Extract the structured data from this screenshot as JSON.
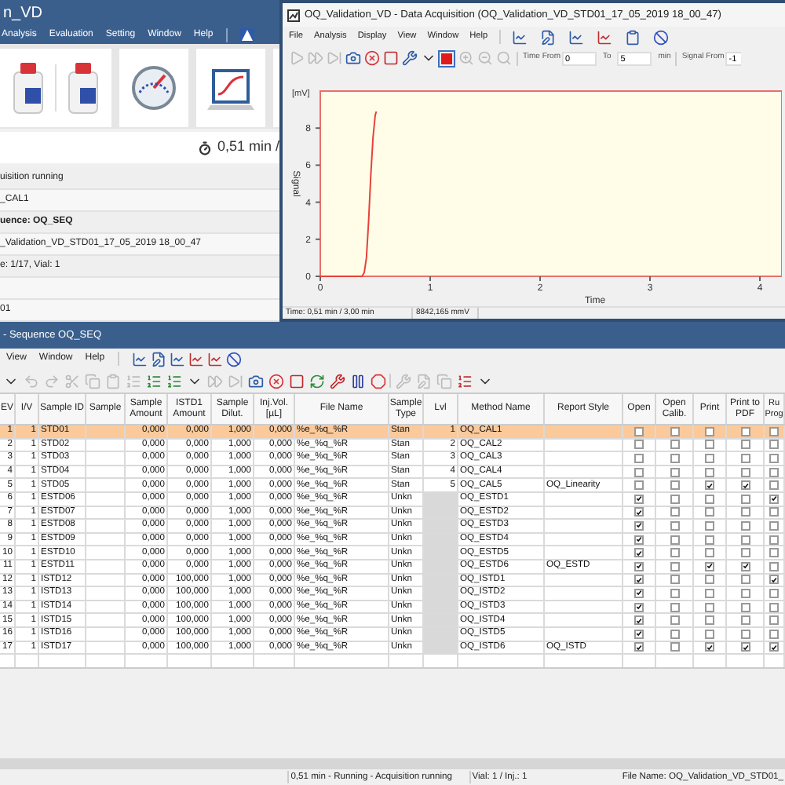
{
  "main_window": {
    "title": "n_VD",
    "menu": [
      "Analysis",
      "Evaluation",
      "Setting",
      "Window",
      "Help"
    ],
    "run_time": "0,51 min /",
    "info_rows": [
      {
        "text": "uisition running",
        "bold": false,
        "blank_before": false
      },
      {
        "text": "_CAL1",
        "bold": false,
        "blank_before": false
      },
      {
        "text": "uence: OQ_SEQ",
        "bold": true,
        "blank_before": false
      },
      {
        "text": "_Validation_VD_STD01_17_05_2019 18_00_47",
        "bold": false,
        "blank_before": false
      },
      {
        "text": "e: 1/17, Vial: 1",
        "bold": false,
        "blank_before": false
      },
      {
        "text": "01",
        "bold": false,
        "blank_before": true
      }
    ]
  },
  "acquisition_window": {
    "title": "OQ_Validation_VD - Data Acquisition (OQ_Validation_VD_STD01_17_05_2019 18_00_47)",
    "menu": [
      "File",
      "Analysis",
      "Display",
      "View",
      "Window",
      "Help"
    ],
    "toolbar": {
      "time_from_label": "Time From",
      "time_from": "0",
      "to_label": "To",
      "time_to": "5",
      "unit": "min",
      "signal_from_label": "Signal From",
      "signal_from": "-1"
    },
    "chart": {
      "unit": "[mV]",
      "chart_data": {
        "type": "line",
        "xlabel": "Time",
        "ylabel": "Signal",
        "x": [
          0,
          0.38,
          0.4,
          0.42,
          0.44,
          0.46,
          0.48,
          0.5,
          0.51
        ],
        "series": [
          {
            "color": "#e8403a",
            "values": [
              0,
              0,
              0.2,
              1.0,
              3.0,
              5.5,
              7.5,
              8.7,
              8.9
            ]
          }
        ],
        "xlim": [
          0,
          4.2
        ],
        "ylim": [
          0,
          10
        ],
        "xticks": [
          0,
          1,
          2,
          3,
          4
        ],
        "yticks": [
          0,
          2,
          4,
          6,
          8
        ]
      }
    },
    "status": [
      "Time: 0,51 min / 3,00 min",
      "8842,165 mmV"
    ]
  },
  "sequence_window": {
    "title": "- Sequence OQ_SEQ",
    "menu": [
      "View",
      "Window",
      "Help"
    ],
    "table": {
      "columns": [
        "EV",
        "I/V",
        "Sample ID",
        "Sample",
        "Sample Amount",
        "ISTD1 Amount",
        "Sample Dilut.",
        "Inj.Vol. [µL]",
        "File Name",
        "Sample Type",
        "Lvl",
        "Method Name",
        "Report Style",
        "Open",
        "Open Calib.",
        "Print",
        "Print to PDF",
        "Ru Prog"
      ],
      "rows": [
        {
          "ev": "1",
          "iv": "1",
          "sample_id": "STD01",
          "sample_amount": "0,000",
          "istd1_amount": "0,000",
          "dilution": "1,000",
          "inj_vol": "0,000",
          "file_name": "%e_%q_%R",
          "sample_type": "Stan",
          "lvl": "1",
          "method": "OQ_CAL1",
          "open": false,
          "open_calib": false,
          "print": false,
          "print_pdf": false,
          "run_prog": false,
          "selected": true
        },
        {
          "ev": "2",
          "iv": "1",
          "sample_id": "STD02",
          "sample_amount": "0,000",
          "istd1_amount": "0,000",
          "dilution": "1,000",
          "inj_vol": "0,000",
          "file_name": "%e_%q_%R",
          "sample_type": "Stan",
          "lvl": "2",
          "method": "OQ_CAL2",
          "open": false,
          "open_calib": false,
          "print": false,
          "print_pdf": false,
          "run_prog": false,
          "selected": false
        },
        {
          "ev": "3",
          "iv": "1",
          "sample_id": "STD03",
          "sample_amount": "0,000",
          "istd1_amount": "0,000",
          "dilution": "1,000",
          "inj_vol": "0,000",
          "file_name": "%e_%q_%R",
          "sample_type": "Stan",
          "lvl": "3",
          "method": "OQ_CAL3",
          "open": false,
          "open_calib": false,
          "print": false,
          "print_pdf": false,
          "run_prog": false,
          "selected": false
        },
        {
          "ev": "4",
          "iv": "1",
          "sample_id": "STD04",
          "sample_amount": "0,000",
          "istd1_amount": "0,000",
          "dilution": "1,000",
          "inj_vol": "0,000",
          "file_name": "%e_%q_%R",
          "sample_type": "Stan",
          "lvl": "4",
          "method": "OQ_CAL4",
          "open": false,
          "open_calib": false,
          "print": false,
          "print_pdf": false,
          "run_prog": false,
          "selected": false
        },
        {
          "ev": "5",
          "iv": "1",
          "sample_id": "STD05",
          "sample_amount": "0,000",
          "istd1_amount": "0,000",
          "dilution": "1,000",
          "inj_vol": "0,000",
          "file_name": "%e_%q_%R",
          "sample_type": "Stan",
          "lvl": "5",
          "method": "OQ_CAL5",
          "report_style": "OQ_Linearity",
          "open": false,
          "open_calib": false,
          "print": true,
          "print_pdf": true,
          "run_prog": false,
          "selected": false
        },
        {
          "ev": "6",
          "iv": "1",
          "sample_id": "ESTD06",
          "sample_amount": "0,000",
          "istd1_amount": "0,000",
          "dilution": "1,000",
          "inj_vol": "0,000",
          "file_name": "%e_%q_%R",
          "sample_type": "Unkn",
          "method": "OQ_ESTD1",
          "open": true,
          "open_calib": false,
          "print": false,
          "print_pdf": false,
          "run_prog": true,
          "selected": false
        },
        {
          "ev": "7",
          "iv": "1",
          "sample_id": "ESTD07",
          "sample_amount": "0,000",
          "istd1_amount": "0,000",
          "dilution": "1,000",
          "inj_vol": "0,000",
          "file_name": "%e_%q_%R",
          "sample_type": "Unkn",
          "method": "OQ_ESTD2",
          "open": true,
          "open_calib": false,
          "print": false,
          "print_pdf": false,
          "run_prog": false,
          "selected": false
        },
        {
          "ev": "8",
          "iv": "1",
          "sample_id": "ESTD08",
          "sample_amount": "0,000",
          "istd1_amount": "0,000",
          "dilution": "1,000",
          "inj_vol": "0,000",
          "file_name": "%e_%q_%R",
          "sample_type": "Unkn",
          "method": "OQ_ESTD3",
          "open": true,
          "open_calib": false,
          "print": false,
          "print_pdf": false,
          "run_prog": false,
          "selected": false
        },
        {
          "ev": "9",
          "iv": "1",
          "sample_id": "ESTD09",
          "sample_amount": "0,000",
          "istd1_amount": "0,000",
          "dilution": "1,000",
          "inj_vol": "0,000",
          "file_name": "%e_%q_%R",
          "sample_type": "Unkn",
          "method": "OQ_ESTD4",
          "open": true,
          "open_calib": false,
          "print": false,
          "print_pdf": false,
          "run_prog": false,
          "selected": false
        },
        {
          "ev": "10",
          "iv": "1",
          "sample_id": "ESTD10",
          "sample_amount": "0,000",
          "istd1_amount": "0,000",
          "dilution": "1,000",
          "inj_vol": "0,000",
          "file_name": "%e_%q_%R",
          "sample_type": "Unkn",
          "method": "OQ_ESTD5",
          "open": true,
          "open_calib": false,
          "print": false,
          "print_pdf": false,
          "run_prog": false,
          "selected": false
        },
        {
          "ev": "11",
          "iv": "1",
          "sample_id": "ESTD11",
          "sample_amount": "0,000",
          "istd1_amount": "0,000",
          "dilution": "1,000",
          "inj_vol": "0,000",
          "file_name": "%e_%q_%R",
          "sample_type": "Unkn",
          "method": "OQ_ESTD6",
          "report_style": "OQ_ESTD",
          "open": true,
          "open_calib": false,
          "print": true,
          "print_pdf": true,
          "run_prog": false,
          "selected": false
        },
        {
          "ev": "12",
          "iv": "1",
          "sample_id": "ISTD12",
          "sample_amount": "0,000",
          "istd1_amount": "100,000",
          "dilution": "1,000",
          "inj_vol": "0,000",
          "file_name": "%e_%q_%R",
          "sample_type": "Unkn",
          "method": "OQ_ISTD1",
          "open": true,
          "open_calib": false,
          "print": false,
          "print_pdf": false,
          "run_prog": true,
          "selected": false
        },
        {
          "ev": "13",
          "iv": "1",
          "sample_id": "ISTD13",
          "sample_amount": "0,000",
          "istd1_amount": "100,000",
          "dilution": "1,000",
          "inj_vol": "0,000",
          "file_name": "%e_%q_%R",
          "sample_type": "Unkn",
          "method": "OQ_ISTD2",
          "open": true,
          "open_calib": false,
          "print": false,
          "print_pdf": false,
          "run_prog": false,
          "selected": false
        },
        {
          "ev": "14",
          "iv": "1",
          "sample_id": "ISTD14",
          "sample_amount": "0,000",
          "istd1_amount": "100,000",
          "dilution": "1,000",
          "inj_vol": "0,000",
          "file_name": "%e_%q_%R",
          "sample_type": "Unkn",
          "method": "OQ_ISTD3",
          "open": true,
          "open_calib": false,
          "print": false,
          "print_pdf": false,
          "run_prog": false,
          "selected": false
        },
        {
          "ev": "15",
          "iv": "1",
          "sample_id": "ISTD15",
          "sample_amount": "0,000",
          "istd1_amount": "100,000",
          "dilution": "1,000",
          "inj_vol": "0,000",
          "file_name": "%e_%q_%R",
          "sample_type": "Unkn",
          "method": "OQ_ISTD4",
          "open": true,
          "open_calib": false,
          "print": false,
          "print_pdf": false,
          "run_prog": false,
          "selected": false
        },
        {
          "ev": "16",
          "iv": "1",
          "sample_id": "ISTD16",
          "sample_amount": "0,000",
          "istd1_amount": "100,000",
          "dilution": "1,000",
          "inj_vol": "0,000",
          "file_name": "%e_%q_%R",
          "sample_type": "Unkn",
          "method": "OQ_ISTD5",
          "open": true,
          "open_calib": false,
          "print": false,
          "print_pdf": false,
          "run_prog": false,
          "selected": false
        },
        {
          "ev": "17",
          "iv": "1",
          "sample_id": "ISTD17",
          "sample_amount": "0,000",
          "istd1_amount": "100,000",
          "dilution": "1,000",
          "inj_vol": "0,000",
          "file_name": "%e_%q_%R",
          "sample_type": "Unkn",
          "method": "OQ_ISTD6",
          "report_style": "OQ_ISTD",
          "open": true,
          "open_calib": false,
          "print": true,
          "print_pdf": true,
          "run_prog": true,
          "selected": false
        }
      ]
    },
    "status_bar": [
      "0,51 min - Running - Acquisition running",
      "Vial: 1 / Inj.: 1",
      "File Name: OQ_Validation_VD_STD01_"
    ]
  }
}
